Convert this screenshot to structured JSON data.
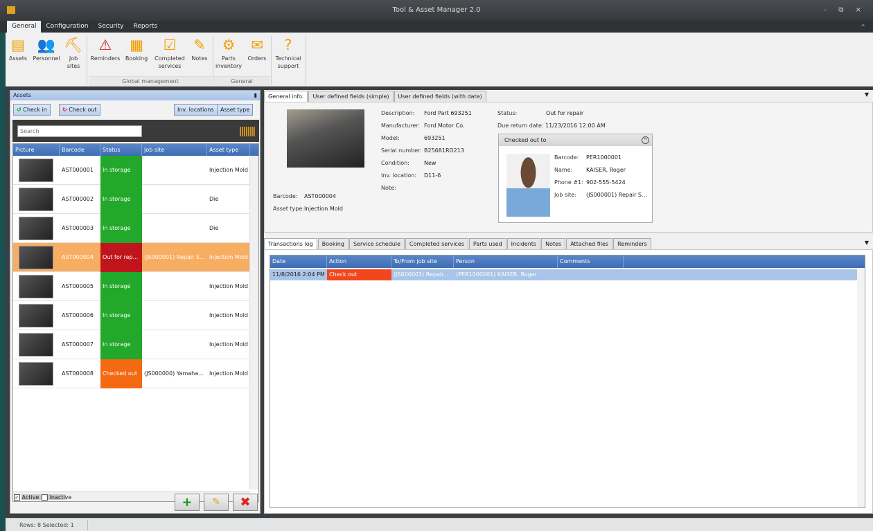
{
  "window": {
    "title": "Tool & Asset Manager 2.0",
    "controls": [
      "–",
      "⧉",
      "×"
    ]
  },
  "menu": {
    "tabs": [
      "General",
      "Configuration",
      "Security",
      "Reports"
    ],
    "active": "General"
  },
  "ribbon": {
    "buttons": [
      {
        "label": "Assets",
        "icon": "assets-icon",
        "glyph": "▤"
      },
      {
        "label": "Personnel",
        "icon": "personnel-icon",
        "glyph": "👥"
      },
      {
        "label": "Job sites",
        "icon": "job-sites-icon",
        "glyph": "⛏"
      },
      {
        "label": "Reminders",
        "icon": "warning-icon",
        "glyph": "⚠"
      },
      {
        "label": "Booking",
        "icon": "calendar-icon",
        "glyph": "▦"
      },
      {
        "label": "Completed services",
        "icon": "checkmark-icon",
        "glyph": "☑"
      },
      {
        "label": "Notes",
        "icon": "notes-icon",
        "glyph": "✎"
      },
      {
        "label": "Parts inventory",
        "icon": "gears-icon",
        "glyph": "⚙"
      },
      {
        "label": "Orders",
        "icon": "orders-icon",
        "glyph": "✉"
      },
      {
        "label": "Technical support",
        "icon": "question-icon",
        "glyph": "?"
      }
    ],
    "groups": [
      "Global management",
      "General"
    ]
  },
  "assets_panel": {
    "title": "Assets",
    "pin_glyph": "▮",
    "check_in": "Check in",
    "check_out": "Check out",
    "inv_locations": "Inv. locations",
    "asset_type": "Asset type",
    "search_placeholder": "Search",
    "columns": [
      "Picture",
      "Barcode",
      "Status",
      "Job site",
      "Asset type"
    ],
    "rows": [
      {
        "barcode": "AST000001",
        "status": "In storage",
        "status_color": "#22a82a",
        "job_site": "",
        "asset_type": "Injection Mold"
      },
      {
        "barcode": "AST000002",
        "status": "In storage",
        "status_color": "#22a82a",
        "job_site": "",
        "asset_type": "Die"
      },
      {
        "barcode": "AST000003",
        "status": "In storage",
        "status_color": "#22a82a",
        "job_site": "",
        "asset_type": "Die"
      },
      {
        "barcode": "AST000004",
        "status": "Out for rep...",
        "status_color": "#c0151c",
        "job_site": "(JS000001) Repair S...",
        "asset_type": "Injection Mold"
      },
      {
        "barcode": "AST000005",
        "status": "In storage",
        "status_color": "#22a82a",
        "job_site": "",
        "asset_type": "Injection Mold"
      },
      {
        "barcode": "AST000006",
        "status": "In storage",
        "status_color": "#22a82a",
        "job_site": "",
        "asset_type": "Injection Mold"
      },
      {
        "barcode": "AST000007",
        "status": "In storage",
        "status_color": "#22a82a",
        "job_site": "",
        "asset_type": "Injection Mold"
      },
      {
        "barcode": "AST000008",
        "status": "Checked out",
        "status_color": "#f36a12",
        "job_site": "(JS000000) Yamaha...",
        "asset_type": "Injection Mold"
      }
    ],
    "active_label": "Active",
    "inactive_label": "Inactive",
    "add": "+",
    "edit": "✎",
    "delete": "✖"
  },
  "details": {
    "tabs": [
      "General info.",
      "User defined fields (simple)",
      "User defined fields (with date)"
    ],
    "description_label": "Description:",
    "description": "Ford Part 693251",
    "manufacturer_label": "Manufacturer:",
    "manufacturer": "Ford Motor Co.",
    "model_label": "Model:",
    "model": "693251",
    "serial_label": "Serial number:",
    "serial": "B25681RD213",
    "condition_label": "Condition:",
    "condition": "New",
    "inv_location_label": "Inv. location:",
    "inv_location": "D11-6",
    "note_label": "Note:",
    "barcode_label": "Barcode:",
    "barcode": "AST000004",
    "asset_type_label": "Asset type:",
    "asset_type": "Injection Mold",
    "status_label": "Status:",
    "status": "Out for repair",
    "due_label": "Due return date:",
    "due": "11/23/2016 12:00 AM",
    "checked_out": {
      "title": "Checked out to",
      "barcode_label": "Barcode:",
      "barcode": "PER1000001",
      "name_label": "Name:",
      "name": "KAISER, Roger",
      "phone_label": "Phone #1:",
      "phone": "902-555-5424",
      "job_site_label": "Job site:",
      "job_site": "(JS000001) Repair S..."
    }
  },
  "log": {
    "tabs": [
      "Transactions log",
      "Booking",
      "Service schedule",
      "Completed services",
      "Parts used",
      "Incidents",
      "Notes",
      "Attached files",
      "Reminders"
    ],
    "columns": [
      "Date",
      "Action",
      "To/From job site",
      "Person",
      "Comments"
    ],
    "rows": [
      {
        "date": "11/8/2016 2:04 PM",
        "action": "Check out",
        "job_site": "(JS000001) Repair...",
        "person": "(PER1000001) KAISER, Roger",
        "comments": ""
      }
    ]
  },
  "statusbar": {
    "text": "Rows: 8  Selected: 1"
  }
}
